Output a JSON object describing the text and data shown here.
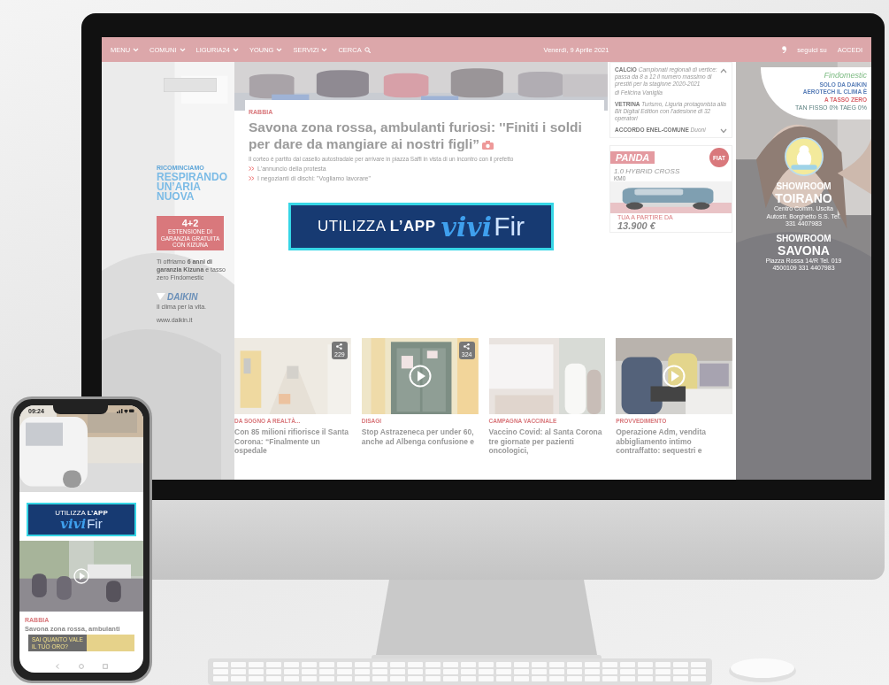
{
  "nav": {
    "items": [
      {
        "label": "MENU"
      },
      {
        "label": "COMUNI"
      },
      {
        "label": "LIGURIA24"
      },
      {
        "label": "YOUNG"
      },
      {
        "label": "SERVIZI"
      }
    ],
    "search": "CERCA",
    "date": "Venerdì, 9 Aprile 2021",
    "follow": "seguici su",
    "login": "ACCEDI"
  },
  "left_ad": {
    "kicker": "RICOMINCIAMO",
    "headline": "RESPIRANDO UN’ARIA NUOVA",
    "badge_big": "4+2",
    "badge_small": "ESTENSIONE DI GARANZIA GRATUITA CON KIZUNA",
    "text": "Ti offriamo **6 anni di garanzia Kizuna** e tasso zero Findomestic",
    "brand": "DAIKIN",
    "tagline": "Il clima per la vita.",
    "url": "www.daikin.it"
  },
  "hero": {
    "category": "RABBIA",
    "title": "Savona zona rossa, ambulanti furiosi: ''Finiti i soldi per dare da mangiare ai nostri figli”",
    "subtitle": "Il corteo è partito dal casello autostradale per arrivare in piazza Saffi in vista di un incontro con il prefetto",
    "links": [
      "L'annuncio della protesta",
      "I negozianti di dischi: \"Vogliamo lavorare\""
    ]
  },
  "app_banner": {
    "text": "UTILIZZA **L’APP**",
    "brand_script": "vivi",
    "brand": "Fir"
  },
  "news": {
    "items": [
      {
        "kind": "toggle",
        "expanded": true,
        "tag": "CALCIO",
        "text": "Campionati regionali di vertice: passa da 8 a 12 il numero massimo di prestiti per la stagione 2020-2021",
        "byline": "di Felicina Vaniglia"
      },
      {
        "kind": "plain",
        "tag": "VETRINA",
        "text": "Turismo, Liguria protagonista alla Bit Digital Edition con l'adesione di 32 operatori"
      },
      {
        "kind": "toggle",
        "expanded": false,
        "tag": "ACCORDO ENEL-COMUNE",
        "text": "Duoni"
      }
    ]
  },
  "panda_ad": {
    "model": "PANDA",
    "version": "1.0 HYBRID CROSS",
    "note": "KM0",
    "brand": "FIAT",
    "price_label": "TUA A PARTIRE DA",
    "price": "13.900 €"
  },
  "right_ad": {
    "brand": "Findomestic",
    "offer": "SOLO DA DAIKIN AEROTECH IL CLIMA È",
    "offer_highlight": "A TASSO ZERO",
    "terms": "TAN FISSO 0% TAEG 0%",
    "showrooms": [
      {
        "label": "SHOWROOM",
        "city": "TOIRANO",
        "address": "Centro Comm. Uscita Autostr. Borghetto S.S. Tel. 331 4407983"
      },
      {
        "label": "SHOWROOM",
        "city": "SAVONA",
        "address": "Piazza Rossa 14/R Tel. 019 4500109 331 4407983"
      }
    ]
  },
  "cards": [
    {
      "category": "DA SOGNO A REALTÀ...",
      "title": "Con 85 milioni rifiorisce il Santa Corona: “Finalmente un ospedale",
      "video": false,
      "shares": "229"
    },
    {
      "category": "DISAGI",
      "title": "Stop Astrazeneca per under 60, anche ad Albenga confusione e",
      "video": true,
      "shares": "324"
    },
    {
      "category": "CAMPAGNA VACCINALE",
      "title": "Vaccino Covid: al Santa Corona tre giornate per pazienti oncologici,",
      "video": false
    },
    {
      "category": "PROVVEDIMENTO",
      "title": "Operazione Adm, vendita abbigliamento intimo contraffatto: sequestri e",
      "video": true
    }
  ],
  "phone": {
    "time": "09:24",
    "app_banner": {
      "text": "UTILIZZA **L’APP**",
      "brand_script": "vivi",
      "brand": "Fir"
    },
    "category": "RABBIA",
    "title": "Savona zona rossa, ambulanti",
    "ad": "SAI QUANTO VALE IL TUO ORO?"
  }
}
